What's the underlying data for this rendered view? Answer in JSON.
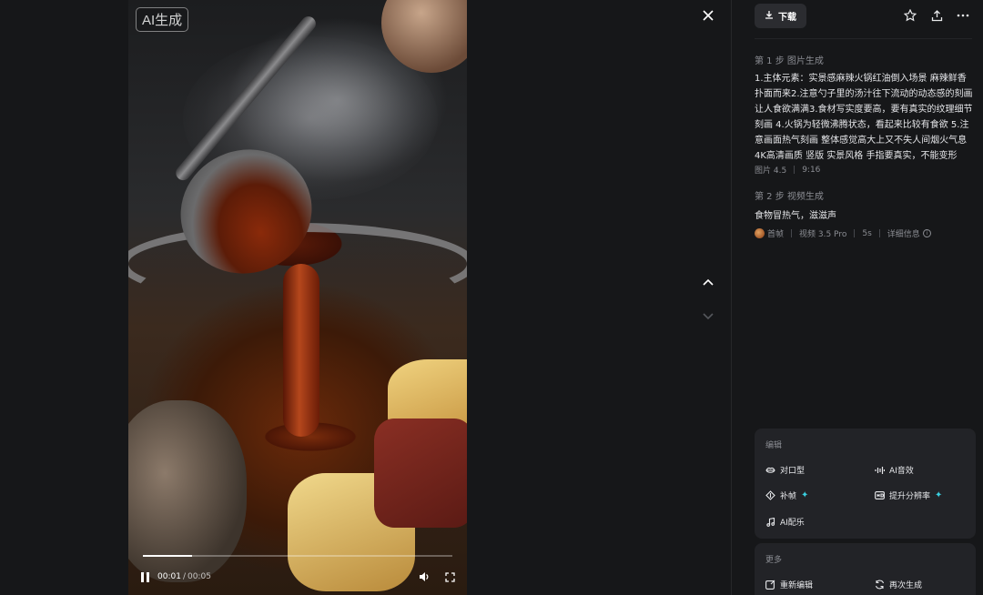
{
  "viewer": {
    "badge": "AI生成",
    "time_current": "00:01",
    "time_separator": "/",
    "time_total": "00:05",
    "progress": 0.16
  },
  "toolbar": {
    "download_label": "下载"
  },
  "step1": {
    "title": "第 1 步 图片生成",
    "prompt": "1.主体元素：实景感麻辣火锅红油倒入场景 麻辣鲜香 扑面而来2.注意勺子里的汤汁往下流动的动态感的刻画 让人食欲满满3.食材写实度要高，要有真实的纹理细节刻画 4.火锅为轻微沸腾状态，看起来比较有食欲 5.注意画面热气刻画 整体感觉高大上又不失人间烟火气息 4K高清画质 竖版 实景风格 手指要真实，不能变形",
    "model": "图片 4.5",
    "ratio": "9:16"
  },
  "step2": {
    "title": "第 2 步 视频生成",
    "prompt": "食物冒热气，滋滋声",
    "frame_label": "首帧",
    "model": "视频 3.5 Pro",
    "duration": "5s",
    "details": "详细信息"
  },
  "edit_card": {
    "title": "编辑",
    "actions": [
      {
        "label": "对口型",
        "icon": "lips-icon"
      },
      {
        "label": "AI音效",
        "icon": "audio-wave-icon"
      },
      {
        "label": "补帧",
        "icon": "frame-interpolate-icon"
      },
      {
        "label": "提升分辨率",
        "icon": "hd-icon"
      },
      {
        "label": "AI配乐",
        "icon": "music-note-icon"
      }
    ]
  },
  "more_card": {
    "title": "更多",
    "actions": [
      {
        "label": "重新编辑",
        "icon": "edit-icon"
      },
      {
        "label": "再次生成",
        "icon": "regenerate-icon"
      }
    ]
  },
  "colors": {
    "background": "#161719",
    "card": "#222327",
    "accent_spark": "#3ad0e0",
    "muted_text": "#8b8d93"
  }
}
